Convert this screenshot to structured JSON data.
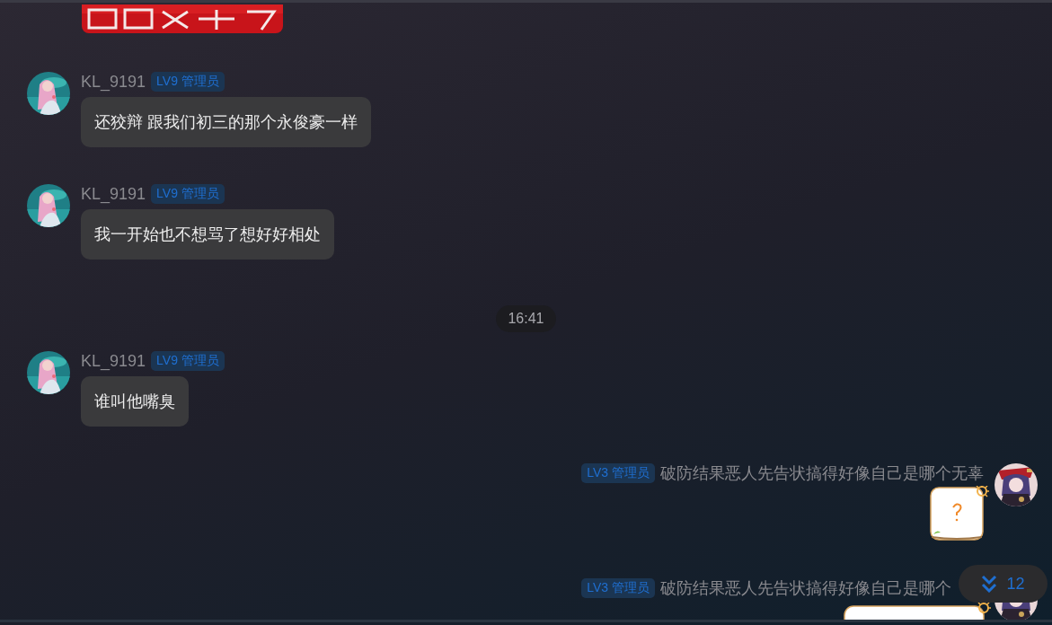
{
  "items": [
    {
      "kind": "incoming",
      "name": "KL_9191",
      "badge": "LV9 管理员",
      "text": "还狡辩 跟我们初三的那个永俊豪一样"
    },
    {
      "kind": "incoming",
      "name": "KL_9191",
      "badge": "LV9 管理员",
      "text": "我一开始也不想骂了想好好相处"
    },
    {
      "kind": "time",
      "text": "16:41"
    },
    {
      "kind": "incoming",
      "name": "KL_9191",
      "badge": "LV9 管理员",
      "text": "谁叫他嘴臭"
    },
    {
      "kind": "outgoing",
      "badge": "LV3 管理员",
      "name": "破防结果恶人先告状搞得好像自己是哪个无辜"
    },
    {
      "kind": "outgoing",
      "badge": "LV3 管理员",
      "name": "破防结果恶人先告状搞得好像自己是哪个"
    }
  ],
  "new_messages_button": {
    "count": "12"
  }
}
